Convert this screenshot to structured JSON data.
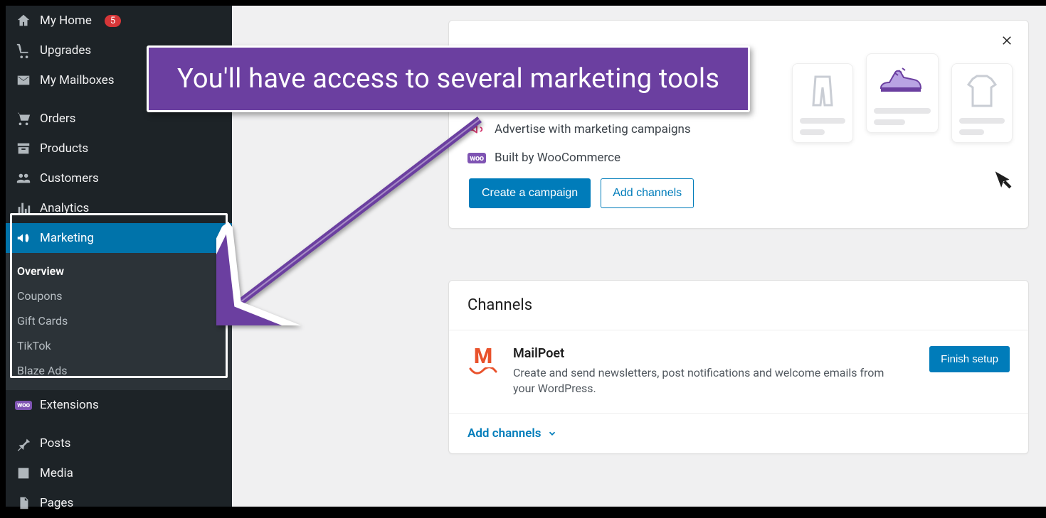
{
  "callout": {
    "text": "You'll have access to several marketing tools"
  },
  "sidebar": {
    "items": [
      {
        "label": "My Home",
        "badge": "5"
      },
      {
        "label": "Upgrades"
      },
      {
        "label": "My Mailboxes"
      },
      {
        "label": "Orders"
      },
      {
        "label": "Products"
      },
      {
        "label": "Customers"
      },
      {
        "label": "Analytics"
      },
      {
        "label": "Marketing",
        "active": true
      },
      {
        "label": "Extensions"
      },
      {
        "label": "Posts"
      },
      {
        "label": "Media"
      },
      {
        "label": "Pages"
      }
    ],
    "submenu": [
      {
        "label": "Overview",
        "current": true
      },
      {
        "label": "Coupons"
      },
      {
        "label": "Gift Cards"
      },
      {
        "label": "TikTok"
      },
      {
        "label": "Blaze Ads"
      }
    ]
  },
  "promo": {
    "feat1": "Advertise with marketing campaigns",
    "feat2_prefix": "Built by ",
    "feat2_brand": "WooCommerce",
    "btn_primary": "Create a campaign",
    "btn_secondary": "Add channels",
    "woo_badge": "woo"
  },
  "channels": {
    "heading": "Channels",
    "item": {
      "title": "MailPoet",
      "desc": "Create and send newsletters, post notifications and welcome emails from your WordPress.",
      "cta": "Finish setup",
      "logo_letter": "M"
    },
    "add_link": "Add channels"
  },
  "colors": {
    "accent": "#007cba",
    "callout_bg": "#6b3fa0",
    "badge_red": "#d63638",
    "woo_purple": "#7f54b3"
  }
}
